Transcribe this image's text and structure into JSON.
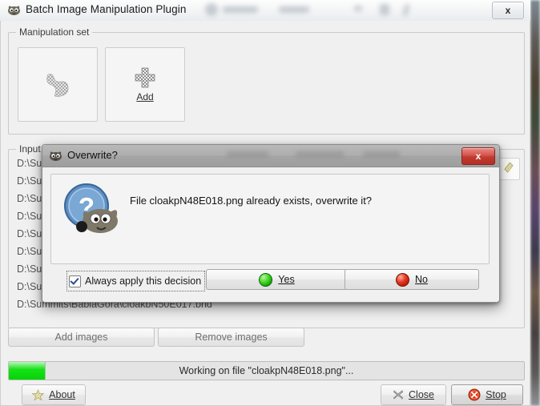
{
  "window": {
    "title": "Batch Image Manipulation Plugin",
    "app_icon": "gimp-wilber-icon",
    "close_label": "x"
  },
  "manipulation_set": {
    "legend": "Manipulation set",
    "preview_icon": "gimp-wilber-icon",
    "add_icon": "plus-icon",
    "add_label": "Add"
  },
  "input_files": {
    "legend": "Input files and options",
    "side_button_icon": "filter-icon",
    "rows": [
      "D:\\Summits\\BabiaGora\\cloakbN50E017.bnd",
      "D:\\Summits\\BabiaGora\\cloakbN50E018.bnd",
      "D:\\Summits\\BabiaGora\\cloakbN50E019.bnd",
      "D:\\Summits\\BabiaGora\\cloakbN49E017.bnd",
      "D:\\Summits\\BabiaGora\\cloakbN49E018.bnd",
      "D:\\Summits\\BabiaGora\\cloakbN49E019.bnd",
      "D:\\Summits\\BabiaGora\\cloakbN48E017.bnd",
      "D:\\Summits\\BabiaGora\\cloakbN48E018.bnd",
      "D:\\Summits\\BabiaGora\\cloakbN50E017.bnd"
    ],
    "add_images_label": "Add images",
    "remove_images_label": "Remove images"
  },
  "progress": {
    "percent": 7,
    "status_text": "Working on file \"cloakpN48E018.png\"..."
  },
  "footer": {
    "about_label": "About",
    "about_icon": "star-icon",
    "close_label": "Close",
    "close_icon": "x-mark-icon",
    "stop_label": "Stop",
    "stop_icon": "stop-circle-icon"
  },
  "dialog": {
    "title": "Overwrite?",
    "title_icon": "gimp-wilber-icon",
    "close_label": "x",
    "message": "File cloakpN48E018.png already exists, overwrite it?",
    "icon": "question-wilber-icon",
    "checkbox_label": "Always apply this decision",
    "checkbox_checked": true,
    "yes_label": "Yes",
    "no_label": "No",
    "yes_led": "#2fc913",
    "no_led": "#d42a12"
  },
  "colors": {
    "window_bg": "#f0f0f0",
    "progress_green": "#18e018",
    "dialog_close_red": "#c33a30"
  }
}
